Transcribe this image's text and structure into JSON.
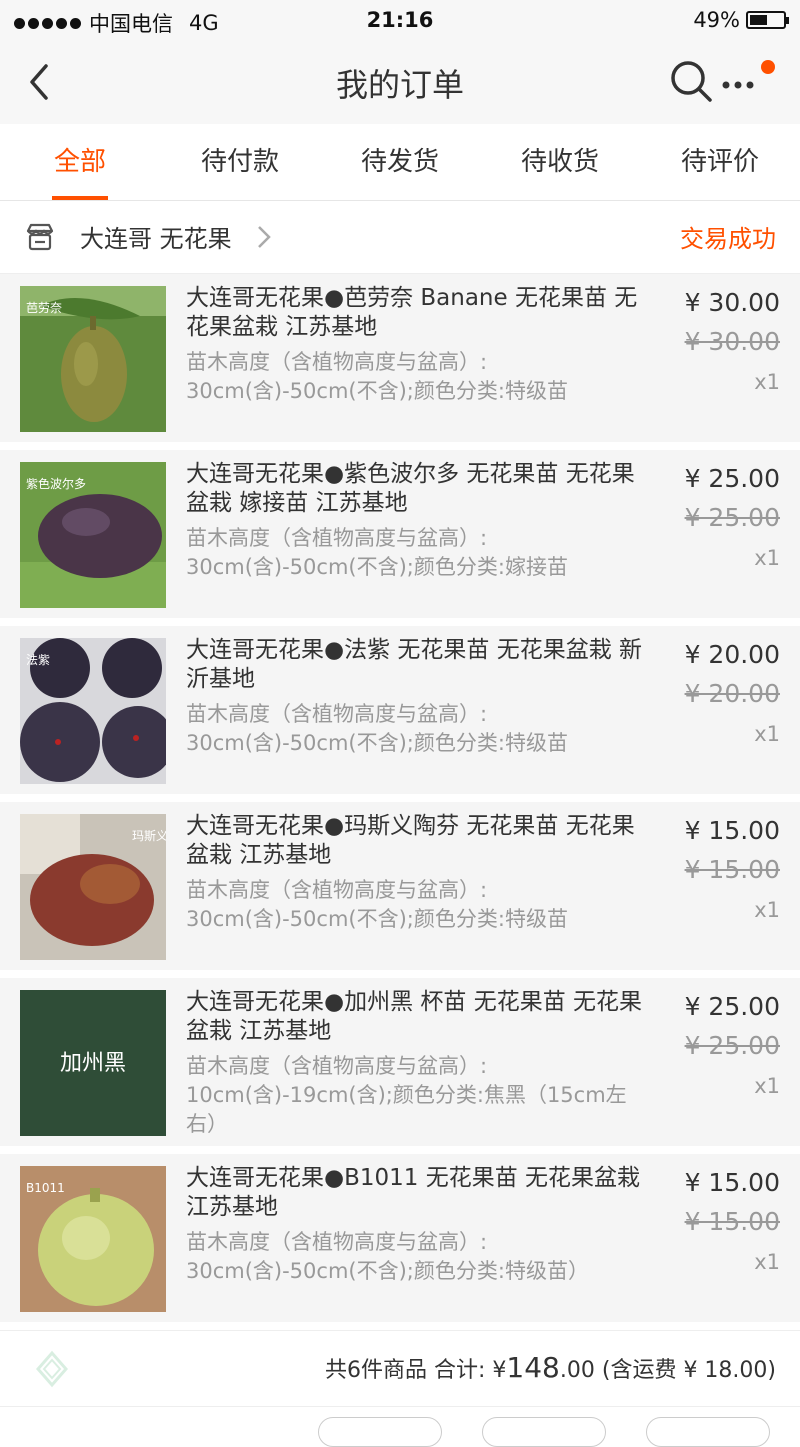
{
  "status_bar": {
    "carrier": "中国电信",
    "network": "4G",
    "time": "21:16",
    "battery": "49%"
  },
  "nav": {
    "title": "我的订单",
    "icons": [
      "back-chevron-icon",
      "search-icon",
      "more-icon"
    ],
    "notification_dot_color": "#ff5000"
  },
  "tabs": [
    {
      "label": "全部",
      "active": true
    },
    {
      "label": "待付款",
      "active": false
    },
    {
      "label": "待发货",
      "active": false
    },
    {
      "label": "待收货",
      "active": false
    },
    {
      "label": "待评价",
      "active": false
    }
  ],
  "shop": {
    "name": "大连哥 无花果",
    "status": "交易成功"
  },
  "items": [
    {
      "name": "大连哥无花果●芭劳奈 Banane 无花果苗 无花果盆栽 江苏基地",
      "spec": "苗木高度（含植物高度与盆高）: 30cm(含)-50cm(不含);颜色分类:特级苗",
      "price": "¥ 30.00",
      "orig_price": "¥ 30.00",
      "qty": "x1",
      "thumb_label": "芭劳奈"
    },
    {
      "name": "大连哥无花果●紫色波尔多 无花果苗 无花果盆栽 嫁接苗 江苏基地",
      "spec": "苗木高度（含植物高度与盆高）: 30cm(含)-50cm(不含);颜色分类:嫁接苗",
      "price": "¥ 25.00",
      "orig_price": "¥ 25.00",
      "qty": "x1",
      "thumb_label": "紫色波尔多"
    },
    {
      "name": "大连哥无花果●法紫 无花果苗 无花果盆栽 新沂基地",
      "spec": "苗木高度（含植物高度与盆高）: 30cm(含)-50cm(不含);颜色分类:特级苗",
      "price": "¥ 20.00",
      "orig_price": "¥ 20.00",
      "qty": "x1",
      "thumb_label": "法紫"
    },
    {
      "name": "大连哥无花果●玛斯义陶芬 无花果苗 无花果盆栽 江苏基地",
      "spec": "苗木高度（含植物高度与盆高）: 30cm(含)-50cm(不含);颜色分类:特级苗",
      "price": "¥ 15.00",
      "orig_price": "¥ 15.00",
      "qty": "x1",
      "thumb_label": "玛斯义陶芬"
    },
    {
      "name": "大连哥无花果●加州黑 杯苗 无花果苗 无花果盆栽 江苏基地",
      "spec": "苗木高度（含植物高度与盆高）: 10cm(含)-19cm(含);颜色分类:焦黑（15cm左右）",
      "price": "¥ 25.00",
      "orig_price": "¥ 25.00",
      "qty": "x1",
      "thumb_label": "加州黑"
    },
    {
      "name": "大连哥无花果●B1011 无花果苗 无花果盆栽 江苏基地",
      "spec": "苗木高度（含植物高度与盆高）: 30cm(含)-50cm(不含);颜色分类:特级苗）",
      "price": "¥ 15.00",
      "orig_price": "¥ 15.00",
      "qty": "x1",
      "thumb_label": "B1011"
    }
  ],
  "summary": {
    "count_text": "共6件商品 合计: ¥",
    "total_int": "148",
    "total_dec": ".00",
    "shipping_text": " (含运费 ¥ 18.00)"
  },
  "colors": {
    "accent": "#ff5000",
    "page_bg": "#f5f5f5"
  }
}
